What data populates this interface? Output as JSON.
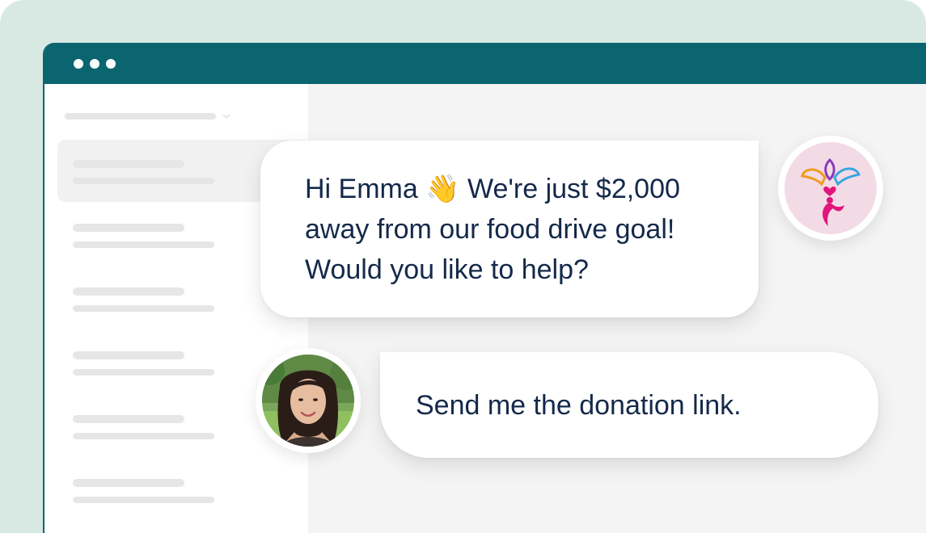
{
  "window": {
    "controls": [
      "dot",
      "dot",
      "dot"
    ]
  },
  "messages": {
    "org_message": "Hi Emma 👋 We're just $2,000\naway from our food drive goal!\nWould you like to help?",
    "user_message": "Send me the donation link."
  },
  "avatars": {
    "org_logo_icon": "lotus-figure-logo",
    "user_photo": "smiling-woman-portrait"
  },
  "colors": {
    "titlebar": "#0a6570",
    "backdrop": "#d8e9e4",
    "text": "#14294a",
    "logo_pink": "#e2157a",
    "logo_blue": "#3aa6e0",
    "logo_orange": "#f39a1e"
  }
}
